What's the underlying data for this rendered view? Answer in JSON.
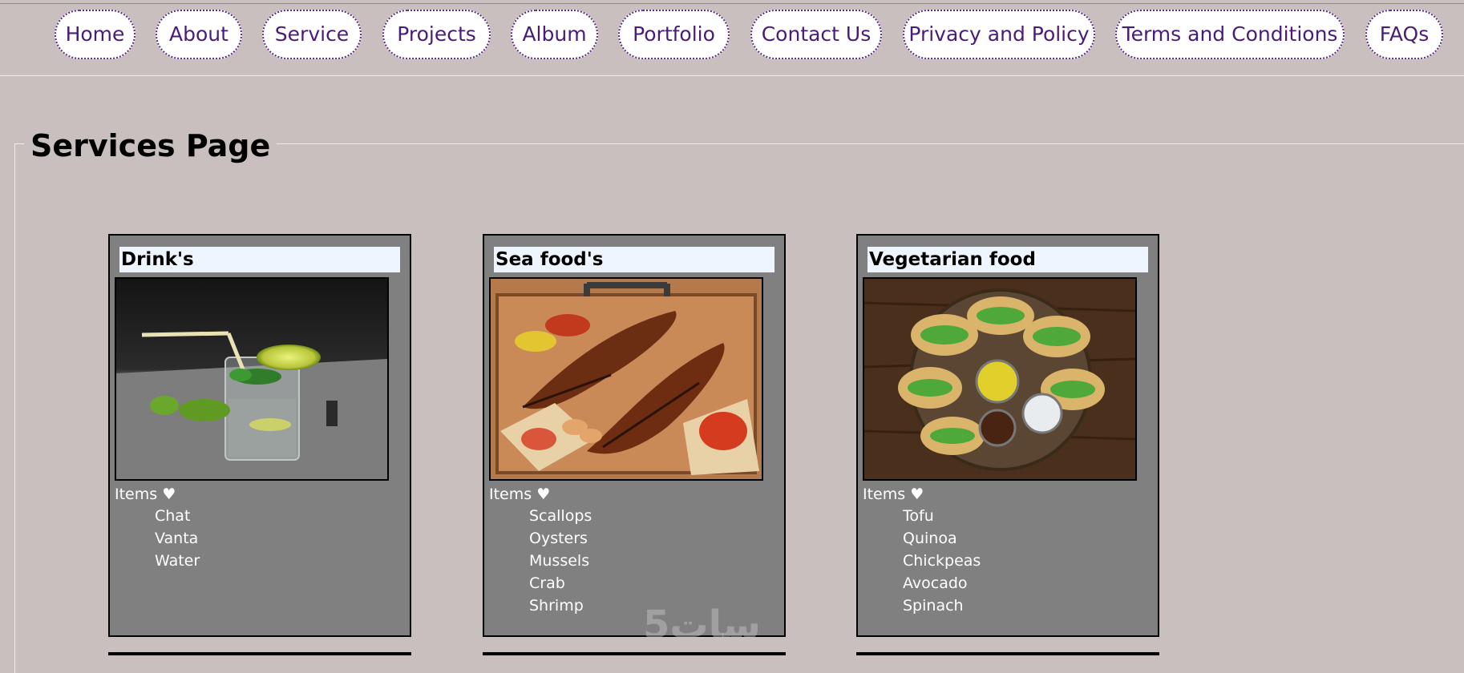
{
  "nav": {
    "items": [
      "Home",
      "About",
      "Service",
      "Projects",
      "Album",
      "Portfolio",
      "Contact Us",
      "Privacy and Policy",
      "Terms and Conditions",
      "FAQs"
    ]
  },
  "page": {
    "title": "Services Page"
  },
  "cards": [
    {
      "title": "Drink's",
      "items_label": "Items ♥",
      "items": [
        "Chat",
        "Vanta",
        "Water"
      ]
    },
    {
      "title": "Sea food's",
      "items_label": "Items ♥",
      "items": [
        "Scallops",
        "Oysters",
        "Mussels",
        "Crab",
        "Shrimp"
      ]
    },
    {
      "title": "Vegetarian food",
      "items_label": "Items ♥",
      "items": [
        "Tofu",
        "Quinoa",
        "Chickpeas",
        "Avocado",
        "Spinach"
      ]
    }
  ],
  "watermark": "5سات",
  "colors": {
    "background": "#c9bfbf",
    "nav_text": "#4a1c7a",
    "card_bg": "#808080",
    "title_bg": "#eef5ff"
  }
}
